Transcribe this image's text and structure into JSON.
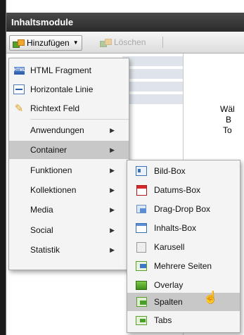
{
  "panel": {
    "title": "Inhaltsmodule"
  },
  "toolbar": {
    "add_label": "Hinzufügen",
    "delete_label": "Löschen"
  },
  "background_text": {
    "line1": "Wäl",
    "line2": "B",
    "line3": "To"
  },
  "main_menu": {
    "items": [
      {
        "label": "HTML Fragment",
        "icon": "html-icon"
      },
      {
        "label": "Horizontale Linie",
        "icon": "horizontal-line-icon"
      },
      {
        "label": "Richtext Feld",
        "icon": "pencil-icon"
      },
      {
        "label": "Anwendungen",
        "has_submenu": true
      },
      {
        "label": "Container",
        "has_submenu": true,
        "highlighted": true
      },
      {
        "label": "Funktionen",
        "has_submenu": true
      },
      {
        "label": "Kollektionen",
        "has_submenu": true
      },
      {
        "label": "Media",
        "has_submenu": true
      },
      {
        "label": "Social",
        "has_submenu": true
      },
      {
        "label": "Statistik",
        "has_submenu": true
      }
    ],
    "submenu_arrow": "▶"
  },
  "container_submenu": {
    "items": [
      {
        "label": "Bild-Box",
        "icon": "image-box-icon"
      },
      {
        "label": "Datums-Box",
        "icon": "calendar-icon"
      },
      {
        "label": "Drag-Drop Box",
        "icon": "drag-drop-icon"
      },
      {
        "label": "Inhalts-Box",
        "icon": "window-icon"
      },
      {
        "label": "Karusell",
        "icon": "carousel-icon"
      },
      {
        "label": "Mehrere Seiten",
        "icon": "pages-icon"
      },
      {
        "label": "Overlay",
        "icon": "overlay-icon"
      },
      {
        "label": "Spalten",
        "icon": "columns-icon",
        "highlighted": true
      },
      {
        "label": "Tabs",
        "icon": "tabs-icon"
      }
    ]
  },
  "colors": {
    "highlight": "#c8c8c8",
    "title_bar": "#333333",
    "menu_bg": "#f4f4f4"
  }
}
